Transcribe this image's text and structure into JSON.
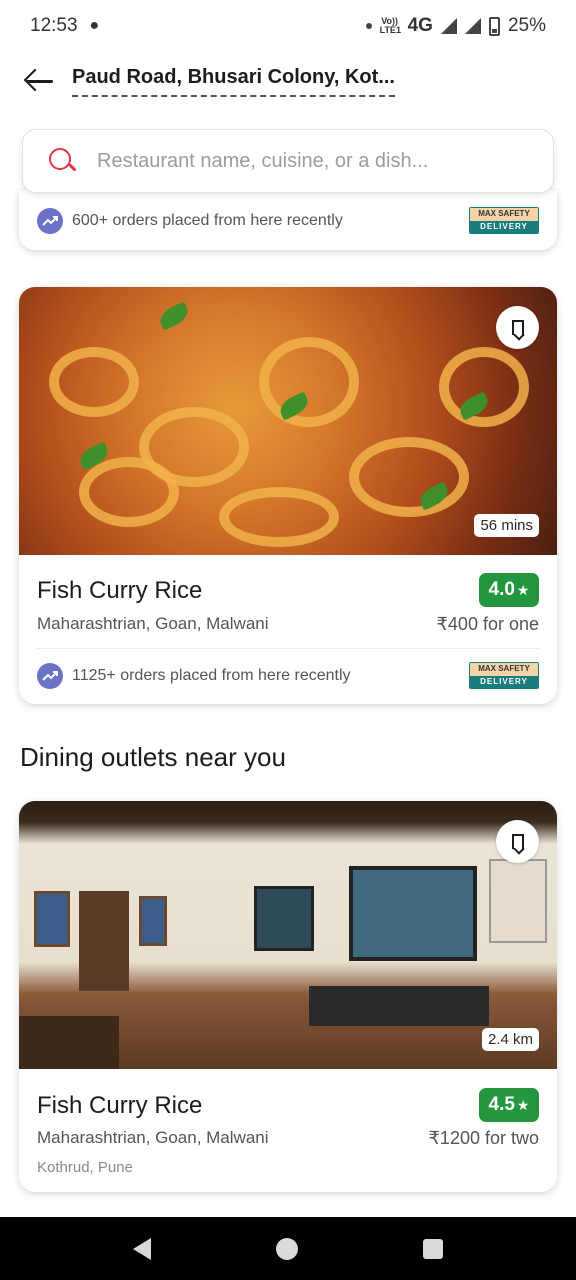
{
  "status_bar": {
    "time": "12:53",
    "network_label": "Vo)) LTE1",
    "network": "4G",
    "battery": "25%"
  },
  "header": {
    "location": "Paud Road, Bhusari Colony, Kot..."
  },
  "search": {
    "placeholder": "Restaurant name, cuisine, or a dish..."
  },
  "prev_card": {
    "orders_text": "600+ orders placed from here recently",
    "badge_top": "MAX SAFETY",
    "badge_bottom": "DELIVERY"
  },
  "delivery_card": {
    "name": "Fish Curry Rice",
    "rating": "4.0",
    "cuisine": "Maharashtrian, Goan, Malwani",
    "price": "₹400 for one",
    "time": "56 mins",
    "orders_text": "1125+ orders placed from here recently",
    "badge_top": "MAX SAFETY",
    "badge_bottom": "DELIVERY",
    "rating_color": "#24963f"
  },
  "dining_section": {
    "title": "Dining outlets near you"
  },
  "dining_card": {
    "name": "Fish Curry Rice",
    "rating": "4.5",
    "cuisine": "Maharashtrian, Goan, Malwani",
    "price": "₹1200 for two",
    "distance": "2.4 km",
    "locality": "Kothrud, Pune",
    "rating_color": "#24963f"
  },
  "icons": {
    "star": "★",
    "trend": "trending-up-icon",
    "bookmark": "bookmark-icon",
    "search": "search-icon",
    "back": "back-arrow-icon"
  },
  "colors": {
    "accent": "#e23744",
    "rating_green": "#24963f",
    "trend_purple": "#6c72c8"
  }
}
